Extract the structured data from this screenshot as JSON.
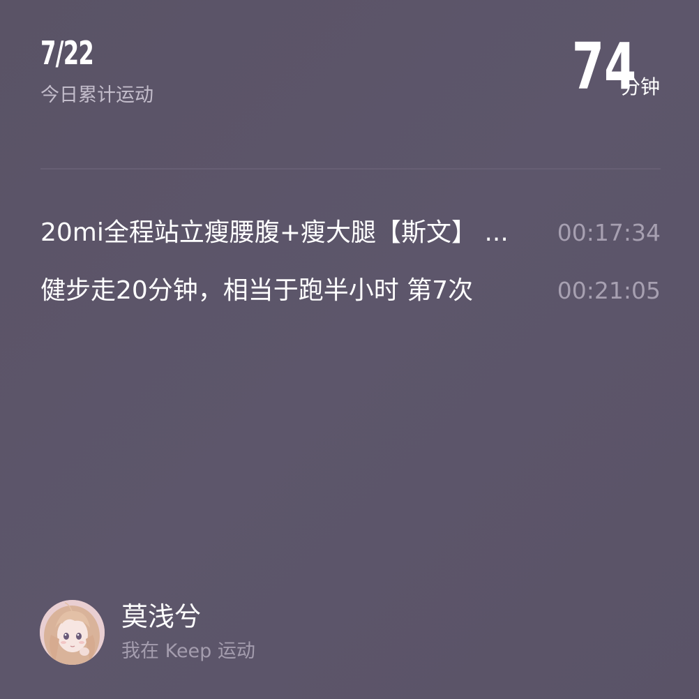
{
  "header": {
    "date": "7/22",
    "subtitle": "今日累计运动",
    "total_value": "74",
    "total_unit": "分钟"
  },
  "activities": [
    {
      "name": "20mi全程站立瘦腰腹+瘦大腿【斯文】 ...",
      "duration": "00:17:34"
    },
    {
      "name": "健步走20分钟，相当于跑半小时 第7次",
      "duration": "00:21:05"
    }
  ],
  "user": {
    "name": "莫浅兮",
    "caption": "我在 Keep 运动",
    "avatar_icon": "anime-girl-avatar"
  },
  "colors": {
    "background": "#5b5468",
    "primary_text": "#ffffff",
    "secondary_text": "#a7a0b1",
    "divider": "#675f74"
  }
}
